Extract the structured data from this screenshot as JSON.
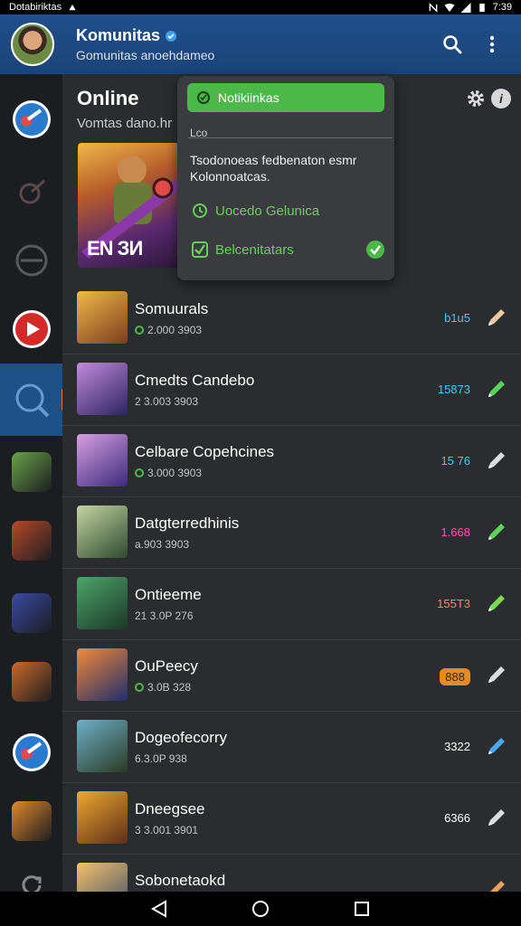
{
  "statusbar": {
    "app_label": "Dotabiriktas",
    "time": "7:39"
  },
  "header": {
    "title": "Komunitas",
    "subtitle": "Gomunitas anoehdameo"
  },
  "section": {
    "title": "Online",
    "subtitle": "Vomtas dano.hr"
  },
  "banner": {
    "text": "EN ЗИ"
  },
  "popup": {
    "pill_label": "Notikiinkas",
    "label": "Lco",
    "text": "Tsodonoeas fedbenaton esmr Kolonnoatcas.",
    "option1": "Uocedo Gelunica",
    "option2": "Belcenitatars"
  },
  "rows": [
    {
      "title": "Somuurals",
      "sub": "2.000 3903",
      "sub_icon": "check",
      "value": "b1u5",
      "value_color": "#4fc3f7",
      "action_color": "#e8c9a0",
      "thumb": [
        "#f2b84a",
        "#7a3d20"
      ]
    },
    {
      "title": "Cmedts Candebo",
      "sub": "2 3.003 3903",
      "sub_icon": "none",
      "value": "15873",
      "value_color": "#4fc3f7",
      "action_color": "#5ad35a",
      "thumb": [
        "#c28bd8",
        "#2a2460"
      ]
    },
    {
      "title": "Celbare Copehcines",
      "sub": "3.000 3903",
      "sub_icon": "check",
      "value": "15 76",
      "value_color": "#4fc3f7",
      "action_color": "#dcdcdc",
      "thumb": [
        "#d7a0e0",
        "#3a2a7a"
      ]
    },
    {
      "title": "Datgterredhinis",
      "sub": "a.903 3903",
      "sub_icon": "none",
      "value": "1.668",
      "value_color": "#ff4fb8",
      "action_color": "#5ad35a",
      "thumb": [
        "#c6d4a2",
        "#2e4a30"
      ]
    },
    {
      "title": "Ontieeme",
      "sub": "21 3.0P 276",
      "sub_icon": "none",
      "value": "155T3",
      "value_color": "#ff8a65",
      "action_color": "#7ed957",
      "thumb": [
        "#4fa36a",
        "#1a3828"
      ]
    },
    {
      "title": "OuPeecy",
      "sub": "3.0B 328",
      "sub_icon": "check",
      "value": "888",
      "value_color": "#3a2a10",
      "value_pill": true,
      "action_color": "#dcdcdc",
      "thumb": [
        "#f08a3a",
        "#1e2e6a"
      ]
    },
    {
      "title": "Dogeofecorry",
      "sub": "6.3.0P 938",
      "sub_icon": "none",
      "value": "3322",
      "value_color": "#ffffff",
      "action_color": "#4aa8f0",
      "thumb": [
        "#6fb0c8",
        "#2a3a22"
      ]
    },
    {
      "title": "Dneegsee",
      "sub": "3 3.001 3901",
      "sub_icon": "none",
      "value": "6366",
      "value_color": "#ffffff",
      "action_color": "#dcdcdc",
      "thumb": [
        "#f0a830",
        "#5a2e1a"
      ]
    },
    {
      "title": "Sobonetaokd",
      "sub": "",
      "sub_icon": "none",
      "value": "",
      "value_color": "#ffffff",
      "action_color": "#e8a060",
      "thumb": [
        "#f3c36a",
        "#3a4a6a"
      ]
    }
  ],
  "sidebar": [
    {
      "kind": "badge",
      "color": "#2a7bd0"
    },
    {
      "kind": "outline",
      "color": "#5a4a4a"
    },
    {
      "kind": "outline2",
      "color": "#5a5a5e"
    },
    {
      "kind": "badge_red",
      "color": "#d42a2a"
    },
    {
      "kind": "search",
      "color": "#1e4f86",
      "active": true
    },
    {
      "kind": "thumb",
      "color": "#6aa24a"
    },
    {
      "kind": "thumb",
      "color": "#b84a2a"
    },
    {
      "kind": "thumb",
      "color": "#3a4aa0"
    },
    {
      "kind": "thumb",
      "color": "#c86a2a"
    },
    {
      "kind": "badge",
      "color": "#2a7bd0"
    },
    {
      "kind": "thumb",
      "color": "#e08a2a"
    },
    {
      "kind": "refresh",
      "color": "#8a8a8a"
    }
  ]
}
